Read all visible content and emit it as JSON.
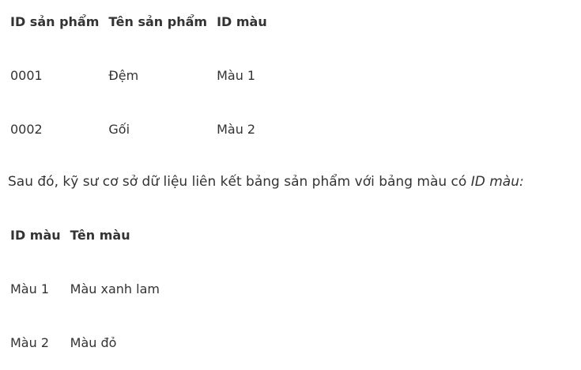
{
  "products_table": {
    "headers": [
      "ID sản phẩm",
      "Tên sản phẩm",
      "ID màu"
    ],
    "rows": [
      [
        "0001",
        "Đệm",
        "Màu 1"
      ],
      [
        "0002",
        "Gối",
        "Màu 2"
      ]
    ]
  },
  "paragraph": {
    "text": "Sau đó, kỹ sư cơ sở dữ liệu liên kết bảng sản phẩm với bảng màu có ",
    "emphasis": "ID màu:"
  },
  "colors_table": {
    "headers": [
      "ID màu",
      "Tên màu"
    ],
    "rows": [
      [
        "Màu 1",
        "Màu xanh lam"
      ],
      [
        "Màu 2",
        "Màu đỏ"
      ]
    ]
  }
}
